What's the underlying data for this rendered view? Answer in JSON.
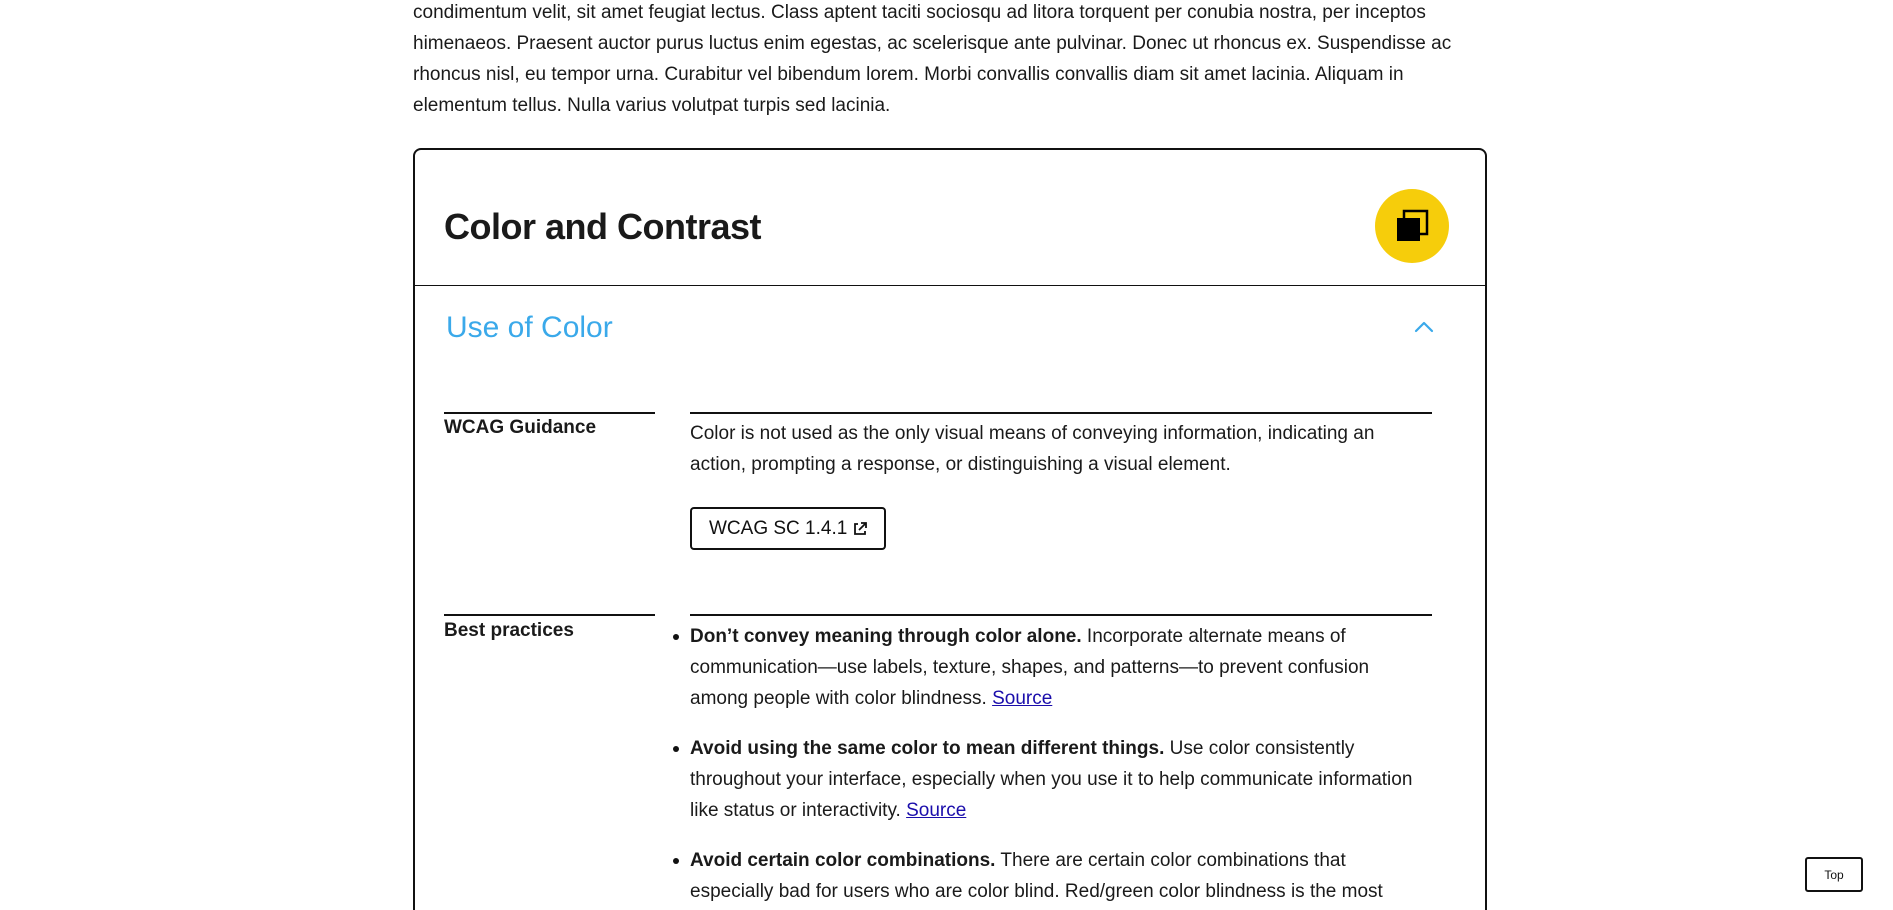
{
  "intro": {
    "text": "condimentum velit, sit amet feugiat lectus. Class aptent taciti sociosqu ad litora torquent per conubia nostra, per inceptos himenaeos. Praesent auctor purus luctus enim egestas, ac scelerisque ante pulvinar. Donec ut rhoncus ex. Suspendisse ac rhoncus nisl, eu tempor urna. Curabitur vel bibendum lorem. Morbi convallis convallis diam sit amet lacinia. Aliquam in elementum tellus. Nulla varius volutpat turpis sed lacinia."
  },
  "card": {
    "title": "Color and Contrast",
    "badge_icon": "overlapping-squares-icon",
    "badge_color": "#f6cd0b",
    "section": {
      "title": "Use of Color",
      "title_color": "#3aa9ea",
      "toggle_icon": "chevron-up-icon",
      "expanded": true
    },
    "wcag": {
      "label": "WCAG Guidance",
      "text": "Color is not used as the only visual means of conveying information, indicating an action, prompting a response, or distinguishing a visual element.",
      "button_label": "WCAG SC 1.4.1",
      "button_icon": "external-link-icon"
    },
    "best_practices": {
      "label": "Best practices",
      "items": [
        {
          "bold": "Don’t convey meaning through color alone.",
          "text": " Incorporate alternate means of communication—use labels, texture, shapes, and patterns—to prevent confusion among people with color blindness. ",
          "link": "Source"
        },
        {
          "bold": "Avoid using the same color to mean different things.",
          "text": " Use color consistently throughout your interface, especially when you use it to help communicate information like status or interactivity. ",
          "link": "Source"
        },
        {
          "bold": "Avoid certain color combinations.",
          "text": " There are certain color combinations that especially bad for users who are color blind. Red/green color blindness is the most",
          "link": ""
        }
      ]
    }
  },
  "top_button": {
    "label": "Top"
  }
}
